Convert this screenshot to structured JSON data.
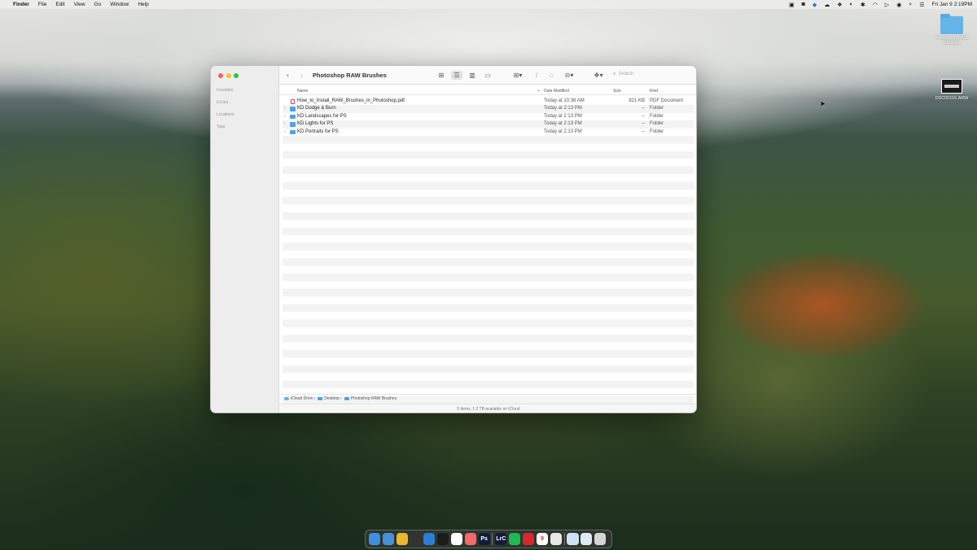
{
  "menubar": {
    "apple_icon": "",
    "app_name": "Finder",
    "menus": [
      "File",
      "Edit",
      "View",
      "Go",
      "Window",
      "Help"
    ],
    "status_icons": [
      "screen-record-icon",
      "app-icon",
      "dropbox-sync-icon",
      "cloud-icon",
      "dropbox-icon",
      "moon-icon",
      "bluetooth-icon",
      "wifi-icon",
      "play-icon",
      "user-icon",
      "search-icon",
      "control-center-icon"
    ],
    "clock": "Fri Jan 9  2:19PM"
  },
  "desktop": {
    "folder_label": "Photoshop RAW Brushes",
    "file_label": "DSC00116.ARW"
  },
  "window": {
    "title": "Photoshop RAW Brushes",
    "sidebar_sections": [
      "Favorites",
      "iCloud",
      "Locations",
      "Tags"
    ],
    "search_placeholder": "Search",
    "columns": {
      "name": "Name",
      "date": "Date Modified",
      "size": "Size",
      "kind": "Kind"
    },
    "files": [
      {
        "name": "How_to_Install_RAW_Brushes_in_Photoshop.pdf",
        "date": "Today at 10:38 AM",
        "size": "821 KB",
        "kind": "PDF Document",
        "type": "pdf"
      },
      {
        "name": "KD Dodge & Burn",
        "date": "Today at 2:13 PM",
        "size": "--",
        "kind": "Folder",
        "type": "folder"
      },
      {
        "name": "KD Landscapes for PS",
        "date": "Today at 2:13 PM",
        "size": "--",
        "kind": "Folder",
        "type": "folder"
      },
      {
        "name": "KD Lights for PS",
        "date": "Today at 2:13 PM",
        "size": "--",
        "kind": "Folder",
        "type": "folder"
      },
      {
        "name": "KD Portraits for PS",
        "date": "Today at 2:13 PM",
        "size": "--",
        "kind": "Folder",
        "type": "folder"
      }
    ],
    "path": [
      "iCloud Drive",
      "Desktop",
      "Photoshop RAW Brushes"
    ],
    "status": "5 items, 1.2 TB available on iCloud"
  },
  "dock": {
    "items": [
      {
        "name": "finder-icon",
        "label": "",
        "color": "#3d8fe0"
      },
      {
        "name": "mail-icon",
        "label": "",
        "color": "#4a90d9"
      },
      {
        "name": "chrome-icon",
        "label": "",
        "color": "#e9b82e"
      },
      {
        "name": "app-icon",
        "label": "",
        "color": "#333333"
      },
      {
        "name": "app-icon",
        "label": "",
        "color": "#2a7fd4"
      },
      {
        "name": "app-icon",
        "label": "",
        "color": "#1c1c1c"
      },
      {
        "name": "slack-icon",
        "label": "",
        "color": "#ffffff"
      },
      {
        "name": "asana-icon",
        "label": "",
        "color": "#f06a6a"
      },
      {
        "name": "photoshop-icon",
        "label": "Ps",
        "color": "#0f1d3b"
      },
      {
        "name": "lightroom-icon",
        "label": "LrC",
        "color": "#0f1d3b"
      },
      {
        "name": "spotify-icon",
        "label": "",
        "color": "#1db954"
      },
      {
        "name": "acrobat-icon",
        "label": "",
        "color": "#d7282f"
      },
      {
        "name": "calendar-icon",
        "label": "9",
        "color": "#ffffff"
      },
      {
        "name": "notes-icon",
        "label": "",
        "color": "#e8e8e8"
      },
      {
        "name": "preview-icon",
        "label": "",
        "color": "#cfe3f5"
      },
      {
        "name": "folder-icon",
        "label": "",
        "color": "#dfe9f3"
      },
      {
        "name": "trash-icon",
        "label": "",
        "color": "#d6d6d6"
      }
    ]
  }
}
